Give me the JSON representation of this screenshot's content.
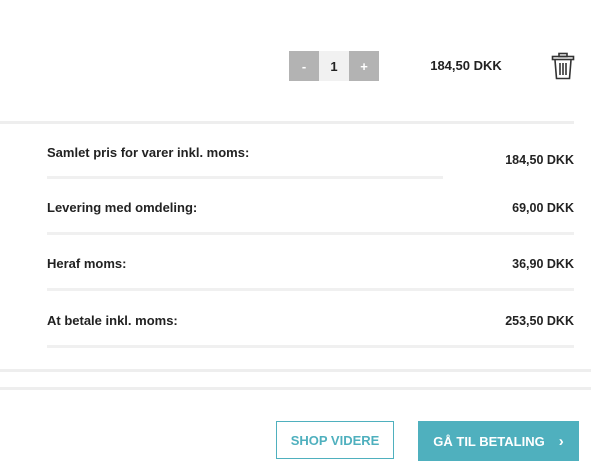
{
  "cart_line": {
    "decrement_label": "-",
    "quantity": "1",
    "increment_label": "+",
    "price": "184,50 DKK"
  },
  "summary": {
    "rows": [
      {
        "label": "Samlet pris for varer inkl. moms:",
        "value": "184,50 DKK"
      },
      {
        "label": "Levering med omdeling:",
        "value": "69,00 DKK"
      },
      {
        "label": "Heraf moms:",
        "value": "36,90 DKK"
      },
      {
        "label": "At betale inkl. moms:",
        "value": "253,50 DKK"
      }
    ]
  },
  "actions": {
    "shop_label": "SHOP VIDERE",
    "pay_label": "GÅ TIL BETALING",
    "pay_chevron": "›"
  },
  "colors": {
    "accent": "#4fb0be",
    "stepper_button": "#b3b3b3",
    "separator": "#eeeeee"
  },
  "icons": {
    "delete": "trash-icon",
    "pay_arrow": "chevron-right-icon"
  }
}
